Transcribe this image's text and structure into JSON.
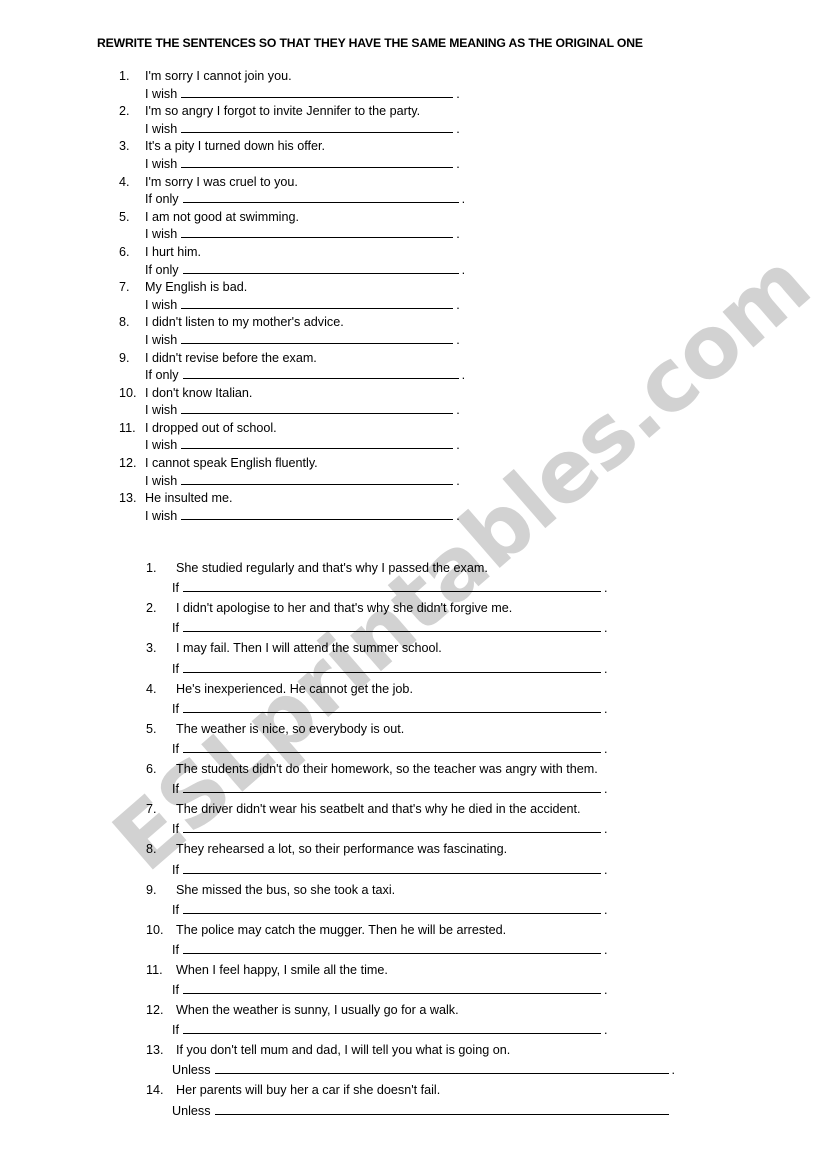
{
  "document": {
    "title": "REWRITE THE SENTENCES SO THAT THEY HAVE THE SAME MEANING AS THE ORIGINAL ONE",
    "watermark": "ESLprintables.com",
    "watermark_color": "#d2d2d2",
    "background_color": "#ffffff",
    "text_color": "#000000"
  },
  "sections": [
    {
      "name": "wishes-regrets",
      "blank_width": 272,
      "items": [
        {
          "number": "1.",
          "sentence": "I'm sorry I cannot join you.",
          "lead": "I wish",
          "terminator": "."
        },
        {
          "number": "2.",
          "sentence": "I'm so angry I forgot to invite Jennifer to the party.",
          "lead": "I wish",
          "terminator": "."
        },
        {
          "number": "3.",
          "sentence": "It's a pity I turned down his offer.",
          "lead": "I wish",
          "terminator": "."
        },
        {
          "number": "4.",
          "sentence": "I'm sorry I was cruel to you.",
          "lead": "If only",
          "terminator": "."
        },
        {
          "number": "5.",
          "sentence": "I am not good at swimming.",
          "lead": "I wish",
          "terminator": "."
        },
        {
          "number": "6.",
          "sentence": "I hurt him.",
          "lead": "If only",
          "terminator": "."
        },
        {
          "number": "7.",
          "sentence": "My English is bad.",
          "lead": "I wish",
          "terminator": "."
        },
        {
          "number": "8.",
          "sentence": "I didn't listen to my mother's advice.",
          "lead": "I wish",
          "terminator": "."
        },
        {
          "number": "9.",
          "sentence": "I didn't revise before the exam.",
          "lead": "If only",
          "terminator": "."
        },
        {
          "number": "10.",
          "sentence": "I don't know Italian.",
          "lead": "I wish",
          "terminator": "."
        },
        {
          "number": "11.",
          "sentence": "I dropped out of school.",
          "lead": "I wish",
          "terminator": "."
        },
        {
          "number": "12.",
          "sentence": "I cannot speak English fluently.",
          "lead": "I wish",
          "terminator": "."
        },
        {
          "number": "13.",
          "sentence": "He insulted me.",
          "lead": "I wish",
          "terminator": "."
        }
      ]
    },
    {
      "name": "conditionals",
      "blank_width": 418,
      "items": [
        {
          "number": "1.",
          "sentence": "She studied regularly and that's why I passed the exam.",
          "lead": "If",
          "terminator": "."
        },
        {
          "number": "2.",
          "sentence": "I didn't apologise to her and that's why she didn't forgive me.",
          "lead": "If",
          "terminator": "."
        },
        {
          "number": "3.",
          "sentence": "I may fail. Then I will attend the summer school.",
          "lead": "If",
          "terminator": "."
        },
        {
          "number": "4.",
          "sentence": "He's inexperienced. He cannot get the job.",
          "lead": "If",
          "terminator": "."
        },
        {
          "number": "5.",
          "sentence": "The weather is nice, so everybody is out.",
          "lead": "If",
          "terminator": "."
        },
        {
          "number": "6.",
          "sentence": "The students didn't do their homework, so the teacher was angry with them.",
          "lead": "If",
          "terminator": "."
        },
        {
          "number": "7.",
          "sentence": "The driver didn't wear his seatbelt and that's why he died in the accident.",
          "lead": "If",
          "terminator": "."
        },
        {
          "number": "8.",
          "sentence": "They rehearsed a lot, so their performance was fascinating.",
          "lead": "If",
          "terminator": "."
        },
        {
          "number": "9.",
          "sentence": "She missed the bus, so she took a taxi.",
          "lead": "If",
          "terminator": "."
        },
        {
          "number": "10.",
          "sentence": "The police may catch the mugger. Then he will be arrested.",
          "lead": "If",
          "terminator": "."
        },
        {
          "number": "11.",
          "sentence": "When I feel happy, I smile all the time.",
          "lead": "If",
          "terminator": "."
        },
        {
          "number": "12.",
          "sentence": "When the weather is sunny, I usually go for a walk.",
          "lead": "If",
          "terminator": "."
        },
        {
          "number": "13.",
          "sentence": "If you don't tell mum and dad, I will tell you what is going on.",
          "lead": "Unless",
          "terminator": "."
        },
        {
          "number": "14.",
          "sentence": "Her parents will buy her a car if she doesn't fail.",
          "lead": "Unless",
          "terminator": ""
        }
      ]
    }
  ]
}
